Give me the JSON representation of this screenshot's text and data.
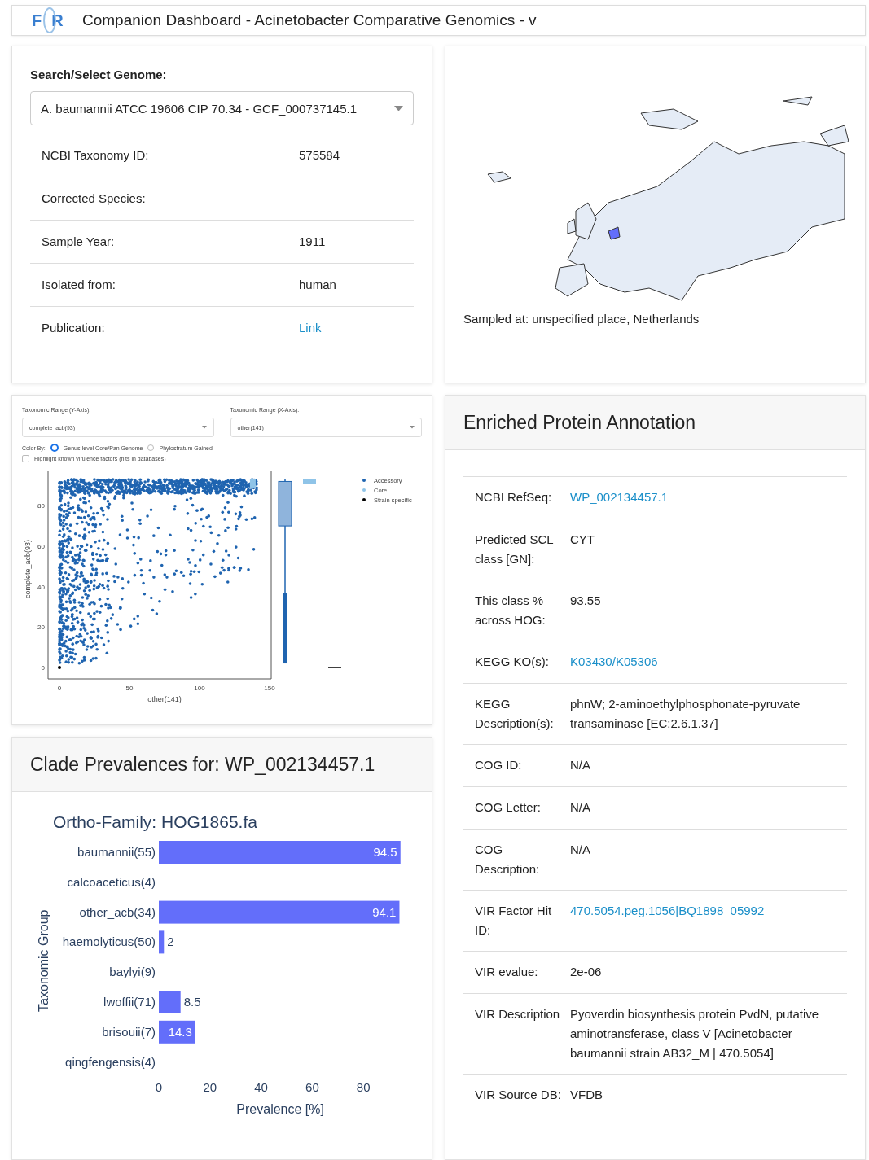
{
  "header": {
    "logo_letters": [
      "F",
      "R"
    ],
    "title": "Companion Dashboard - Acinetobacter Comparative Genomics - v"
  },
  "genome_card": {
    "label": "Search/Select Genome:",
    "selected_genome": "A. baumannii ATCC 19606 CIP 70.34 - GCF_000737145.1",
    "fields": [
      {
        "label": "NCBI Taxonomy ID:",
        "value": "575584",
        "kind": "text"
      },
      {
        "label": "Corrected Species:"
      },
      {
        "label": "Sample Year:",
        "value": "1911",
        "kind": "text"
      },
      {
        "label": "Isolated from:",
        "value": "human",
        "kind": "text"
      },
      {
        "label": "Publication:",
        "value": "Link",
        "kind": "link"
      }
    ]
  },
  "location_card": {
    "caption": "Sampled at: unspecified place, Netherlands"
  },
  "scatter_card": {
    "y_range": {
      "label": "Taxonomic Range (Y-Axis):",
      "value": "complete_acb(93)"
    },
    "x_range": {
      "label": "Taxonomic Range (X-Axis):",
      "value": "other(141)"
    },
    "color_by": {
      "label": "Color By:",
      "options": [
        {
          "label": "Genus-level Core/Pan Genome",
          "selected": true
        },
        {
          "label": "Phylostratum Gained",
          "selected": false
        }
      ]
    },
    "highlight": {
      "label": "Highlight known virulence factors (hits in databases)",
      "checked": false
    },
    "plot": {
      "xlabel": "other(141)",
      "ylabel": "complete_acb(93)",
      "xticks": [
        "0",
        "50",
        "100",
        "150"
      ],
      "yticks": [
        "80",
        "60",
        "40",
        "20",
        "0"
      ],
      "legend": [
        {
          "label": "Accessory",
          "color": "#1f64b0"
        },
        {
          "label": "Core",
          "color": "#8fc4e8"
        },
        {
          "label": "Strain specific",
          "color": "#000000"
        }
      ]
    }
  },
  "clade_card": {
    "title": "Clade Prevalences for: WP_002134457.1",
    "chart_data": {
      "type": "bar",
      "orientation": "horizontal",
      "title": "Ortho-Family: HOG1865.fa",
      "xlabel": "Prevalence [%]",
      "ylabel": "Taxonomic Group",
      "categories": [
        "baumannii(55)",
        "calcoaceticus(4)",
        "other_acb(34)",
        "haemolyticus(50)",
        "baylyi(9)",
        "lwoffii(71)",
        "brisouii(7)",
        "qingfengensis(4)"
      ],
      "series": [
        {
          "color": "#636efa",
          "values": [
            94.5,
            null,
            94.1,
            2,
            null,
            8.5,
            14.3,
            null
          ]
        }
      ],
      "xlim": [
        0,
        95
      ],
      "xticks": [
        0,
        20,
        40,
        60,
        80
      ],
      "data_labels": true
    }
  },
  "annotation_card": {
    "title": "Enriched Protein Annotation",
    "rows": [
      {
        "label": "NCBI RefSeq:",
        "value": "WP_002134457.1",
        "kind": "link"
      },
      {
        "label": "Predicted SCL class [GN]:",
        "value": "CYT",
        "kind": "text"
      },
      {
        "label": "This class % across HOG:",
        "value": "93.55",
        "kind": "text"
      },
      {
        "label": "KEGG KO(s):",
        "value": "K03430/K05306",
        "kind": "link"
      },
      {
        "label": "KEGG Description(s):",
        "value": "phnW; 2-aminoethylphosphonate-pyruvate transaminase [EC:2.6.1.37]",
        "kind": "text"
      },
      {
        "label": "COG ID:",
        "value": "N/A",
        "kind": "text"
      },
      {
        "label": "COG Letter:",
        "value": "N/A",
        "kind": "text"
      },
      {
        "label": "COG Description:",
        "value": "N/A",
        "kind": "text"
      },
      {
        "label": "VIR Factor Hit ID:",
        "value": "470.5054.peg.1056|BQ1898_05992",
        "kind": "link"
      },
      {
        "label": "VIR evalue:",
        "value": "2e-06",
        "kind": "text"
      },
      {
        "label": "VIR Description",
        "value": "Pyoverdin biosynthesis protein PvdN, putative aminotransferase, class V [Acinetobacter baumannii strain AB32_M | 470.5054]",
        "kind": "text"
      },
      {
        "label": "VIR Source DB:",
        "value": "VFDB",
        "kind": "text"
      }
    ]
  }
}
